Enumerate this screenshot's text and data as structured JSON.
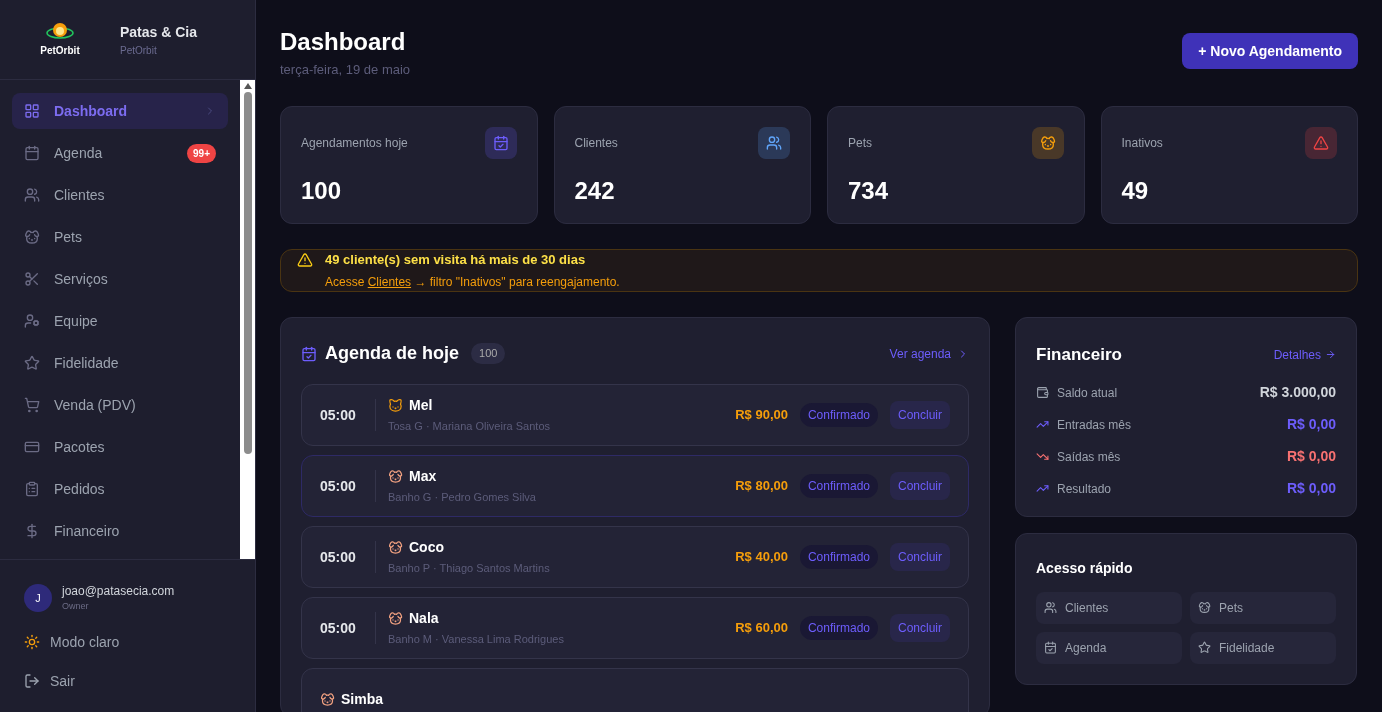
{
  "sidebar": {
    "logo_text": "PetOrbit",
    "brand": "Patas & Cia",
    "subtitle": "PetOrbit",
    "items": [
      {
        "kind": "dashboard",
        "label": "Dashboard",
        "selected": true
      },
      {
        "kind": "calendar",
        "label": "Agenda",
        "selected": false,
        "badge": "99+"
      },
      {
        "kind": "users",
        "label": "Clientes",
        "selected": false
      },
      {
        "kind": "dog",
        "label": "Pets",
        "selected": false
      },
      {
        "kind": "scissors",
        "label": "Serviços",
        "selected": false
      },
      {
        "kind": "team",
        "label": "Equipe",
        "selected": false
      },
      {
        "kind": "star",
        "label": "Fidelidade",
        "selected": false
      },
      {
        "kind": "cart",
        "label": "Venda (PDV)",
        "selected": false
      },
      {
        "kind": "card",
        "label": "Pacotes",
        "selected": false
      },
      {
        "kind": "clipboard",
        "label": "Pedidos",
        "selected": false
      },
      {
        "kind": "dollar",
        "label": "Financeiro",
        "selected": false
      }
    ],
    "user": {
      "initial": "J",
      "email": "joao@patasecia.com",
      "role": "Owner"
    },
    "footer": [
      {
        "kind": "sun",
        "label": "Modo claro"
      },
      {
        "kind": "logout",
        "label": "Sair"
      }
    ]
  },
  "header": {
    "title": "Dashboard",
    "date": "terça-feira, 19 de maio",
    "button": "+ Novo Agendamento"
  },
  "stats": [
    {
      "label": "Agendamentos hoje",
      "value": "100",
      "kind": "calendar",
      "color": "#6d5dfc"
    },
    {
      "label": "Clientes",
      "value": "242",
      "kind": "users",
      "color": "#60a5fa"
    },
    {
      "label": "Pets",
      "value": "734",
      "kind": "dog",
      "color": "#f59e0b"
    },
    {
      "label": "Inativos",
      "value": "49",
      "kind": "alert",
      "color": "#ef4444"
    }
  ],
  "alert": {
    "title": "49 cliente(s) sem visita há mais de 30 dias",
    "before": "Acesse",
    "link": "Clientes",
    "after": "→ filtro \"Inativos\" para reengajamento."
  },
  "agenda": {
    "title": "Agenda de hoje",
    "count": "100",
    "link": "Ver agenda",
    "rows": [
      {
        "time": "05:00",
        "kind": "cat",
        "name": "Mel",
        "detail": "Tosa G · Mariana Oliveira Santos",
        "price": "R$ 90,00",
        "status": "Confirmado",
        "action": "Concluir",
        "selected": false
      },
      {
        "time": "05:00",
        "kind": "dog",
        "name": "Max",
        "detail": "Banho G · Pedro Gomes Silva",
        "price": "R$ 80,00",
        "status": "Confirmado",
        "action": "Concluir",
        "selected": true
      },
      {
        "time": "05:00",
        "kind": "dog",
        "name": "Coco",
        "detail": "Banho P · Thiago Santos Martins",
        "price": "R$ 40,00",
        "status": "Confirmado",
        "action": "Concluir",
        "selected": false
      },
      {
        "time": "05:00",
        "kind": "dog",
        "name": "Nala",
        "detail": "Banho M · Vanessa Lima Rodrigues",
        "price": "R$ 60,00",
        "status": "Confirmado",
        "action": "Concluir",
        "selected": false
      },
      {
        "kind": "dog",
        "name": "Simba",
        "selected": false
      }
    ]
  },
  "finance": {
    "title": "Financeiro",
    "link": "Detalhes",
    "rows": [
      {
        "kind": "wallet",
        "label": "Saldo atual",
        "value": "R$ 3.000,00",
        "color": "#d1d5db"
      },
      {
        "kind": "up",
        "label": "Entradas mês",
        "value": "R$ 0,00",
        "color": "#6d5dfc"
      },
      {
        "kind": "down",
        "label": "Saídas mês",
        "value": "R$ 0,00",
        "color": "#f87171"
      },
      {
        "kind": "up",
        "label": "Resultado",
        "value": "R$ 0,00",
        "color": "#6d5dfc"
      }
    ]
  },
  "quick": {
    "title": "Acesso rápido",
    "items": [
      {
        "kind": "users",
        "label": "Clientes"
      },
      {
        "kind": "dog",
        "label": "Pets"
      },
      {
        "kind": "calendar",
        "label": "Agenda"
      },
      {
        "kind": "star",
        "label": "Fidelidade"
      }
    ]
  }
}
